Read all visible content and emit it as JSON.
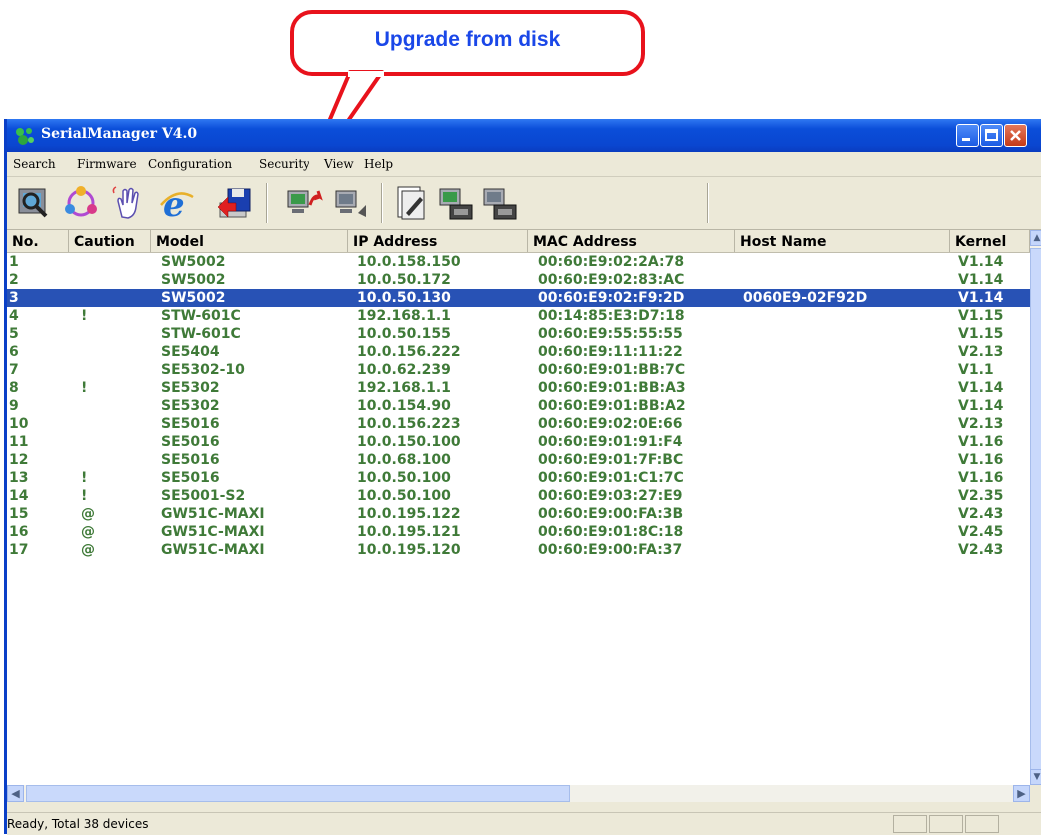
{
  "callout": {
    "text": "Upgrade from disk"
  },
  "window": {
    "title": "SerialManager V4.0"
  },
  "menu": [
    "Search",
    "Firmware",
    "Configuration",
    "Security",
    "View",
    "Help"
  ],
  "toolbar": {
    "icons": [
      "search-device-icon",
      "network-config-icon",
      "locate-hand-icon",
      "internet-explorer-icon",
      "upgrade-from-disk-icon",
      "device-upgrade-icon",
      "device-export-icon",
      "config-file-icon",
      "device-backup-icon",
      "device-restore-icon"
    ]
  },
  "table": {
    "columns": [
      "No.",
      "Caution",
      "Model",
      "IP Address",
      "MAC Address",
      "Host Name",
      "Kernel"
    ],
    "selected_row": 3,
    "rows": [
      {
        "no": "1",
        "caution": "",
        "model": "SW5002",
        "ip": "10.0.158.150",
        "mac": "00:60:E9:02:2A:78",
        "host": "",
        "kernel": "V1.14"
      },
      {
        "no": "2",
        "caution": "",
        "model": "SW5002",
        "ip": "10.0.50.172",
        "mac": "00:60:E9:02:83:AC",
        "host": "",
        "kernel": "V1.14"
      },
      {
        "no": "3",
        "caution": "",
        "model": "SW5002",
        "ip": "10.0.50.130",
        "mac": "00:60:E9:02:F9:2D",
        "host": "0060E9-02F92D",
        "kernel": "V1.14"
      },
      {
        "no": "4",
        "caution": "!",
        "model": "STW-601C",
        "ip": "192.168.1.1",
        "mac": "00:14:85:E3:D7:18",
        "host": "",
        "kernel": "V1.15"
      },
      {
        "no": "5",
        "caution": "",
        "model": "STW-601C",
        "ip": "10.0.50.155",
        "mac": "00:60:E9:55:55:55",
        "host": "",
        "kernel": "V1.15"
      },
      {
        "no": "6",
        "caution": "",
        "model": "SE5404",
        "ip": "10.0.156.222",
        "mac": "00:60:E9:11:11:22",
        "host": "",
        "kernel": "V2.13"
      },
      {
        "no": "7",
        "caution": "",
        "model": "SE5302-10",
        "ip": "10.0.62.239",
        "mac": "00:60:E9:01:BB:7C",
        "host": "",
        "kernel": "V1.1"
      },
      {
        "no": "8",
        "caution": "!",
        "model": "SE5302",
        "ip": "192.168.1.1",
        "mac": "00:60:E9:01:BB:A3",
        "host": "",
        "kernel": "V1.14"
      },
      {
        "no": "9",
        "caution": "",
        "model": "SE5302",
        "ip": "10.0.154.90",
        "mac": "00:60:E9:01:BB:A2",
        "host": "",
        "kernel": "V1.14"
      },
      {
        "no": "10",
        "caution": "",
        "model": "SE5016",
        "ip": "10.0.156.223",
        "mac": "00:60:E9:02:0E:66",
        "host": "",
        "kernel": "V2.13"
      },
      {
        "no": "11",
        "caution": "",
        "model": "SE5016",
        "ip": "10.0.150.100",
        "mac": "00:60:E9:01:91:F4",
        "host": "",
        "kernel": "V1.16"
      },
      {
        "no": "12",
        "caution": "",
        "model": "SE5016",
        "ip": "10.0.68.100",
        "mac": "00:60:E9:01:7F:BC",
        "host": "",
        "kernel": "V1.16"
      },
      {
        "no": "13",
        "caution": "!",
        "model": "SE5016",
        "ip": "10.0.50.100",
        "mac": "00:60:E9:01:C1:7C",
        "host": "",
        "kernel": "V1.16"
      },
      {
        "no": "14",
        "caution": "!",
        "model": "SE5001-S2",
        "ip": "10.0.50.100",
        "mac": "00:60:E9:03:27:E9",
        "host": "",
        "kernel": "V2.35"
      },
      {
        "no": "15",
        "caution": "@",
        "model": "GW51C-MAXI",
        "ip": "10.0.195.122",
        "mac": "00:60:E9:00:FA:3B",
        "host": "",
        "kernel": "V2.43"
      },
      {
        "no": "16",
        "caution": "@",
        "model": "GW51C-MAXI",
        "ip": "10.0.195.121",
        "mac": "00:60:E9:01:8C:18",
        "host": "",
        "kernel": "V2.45"
      },
      {
        "no": "17",
        "caution": "@",
        "model": "GW51C-MAXI",
        "ip": "10.0.195.120",
        "mac": "00:60:E9:00:FA:37",
        "host": "",
        "kernel": "V2.43"
      }
    ]
  },
  "status": {
    "text": "Ready, Total 38 devices"
  }
}
